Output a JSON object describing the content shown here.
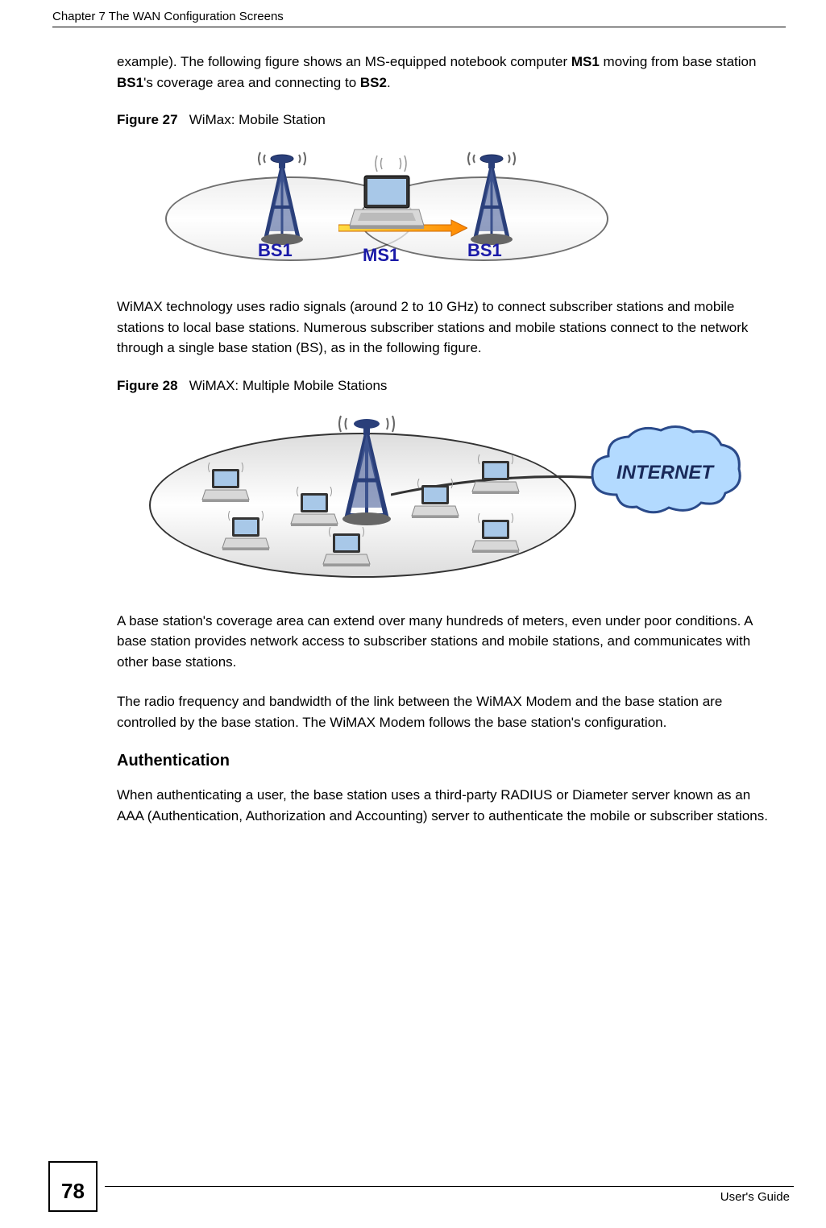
{
  "header": {
    "chapter_title": "Chapter 7 The WAN Configuration Screens"
  },
  "content": {
    "intro_p1_before_ms1": "example). The following figure shows an MS-equipped notebook computer ",
    "intro_p1_ms1": "MS1",
    "intro_p1_between": " moving from base station ",
    "intro_p1_bs1": "BS1",
    "intro_p1_between2": "'s coverage area and connecting to ",
    "intro_p1_bs2": "BS2",
    "intro_p1_end": ".",
    "fig27": {
      "number": "Figure 27",
      "title": "WiMax: Mobile Station",
      "label_bs1_left": "BS1",
      "label_ms1": "MS1",
      "label_bs1_right": "BS1"
    },
    "p2": "WiMAX technology uses radio signals (around 2 to 10 GHz) to connect subscriber stations and mobile stations to local base stations. Numerous subscriber stations and mobile stations connect to the network through a single base station (BS), as in the following figure.",
    "fig28": {
      "number": "Figure 28",
      "title": "WiMAX: Multiple Mobile Stations",
      "internet_label": "INTERNET"
    },
    "p3": "A base station's coverage area can extend over many hundreds of meters, even under poor conditions. A base station provides network access to subscriber stations and mobile stations, and communicates with other base stations.",
    "p4": "The radio frequency and bandwidth of the link between the WiMAX Modem and the base station are controlled by the base station. The WiMAX Modem follows the base station's configuration.",
    "auth_title": "Authentication",
    "p5": "When authenticating a user, the base station uses a third-party RADIUS or Diameter server known as an AAA (Authentication, Authorization and Accounting) server to authenticate the mobile or subscriber stations."
  },
  "footer": {
    "page_number": "78",
    "guide_text": "User's Guide"
  }
}
